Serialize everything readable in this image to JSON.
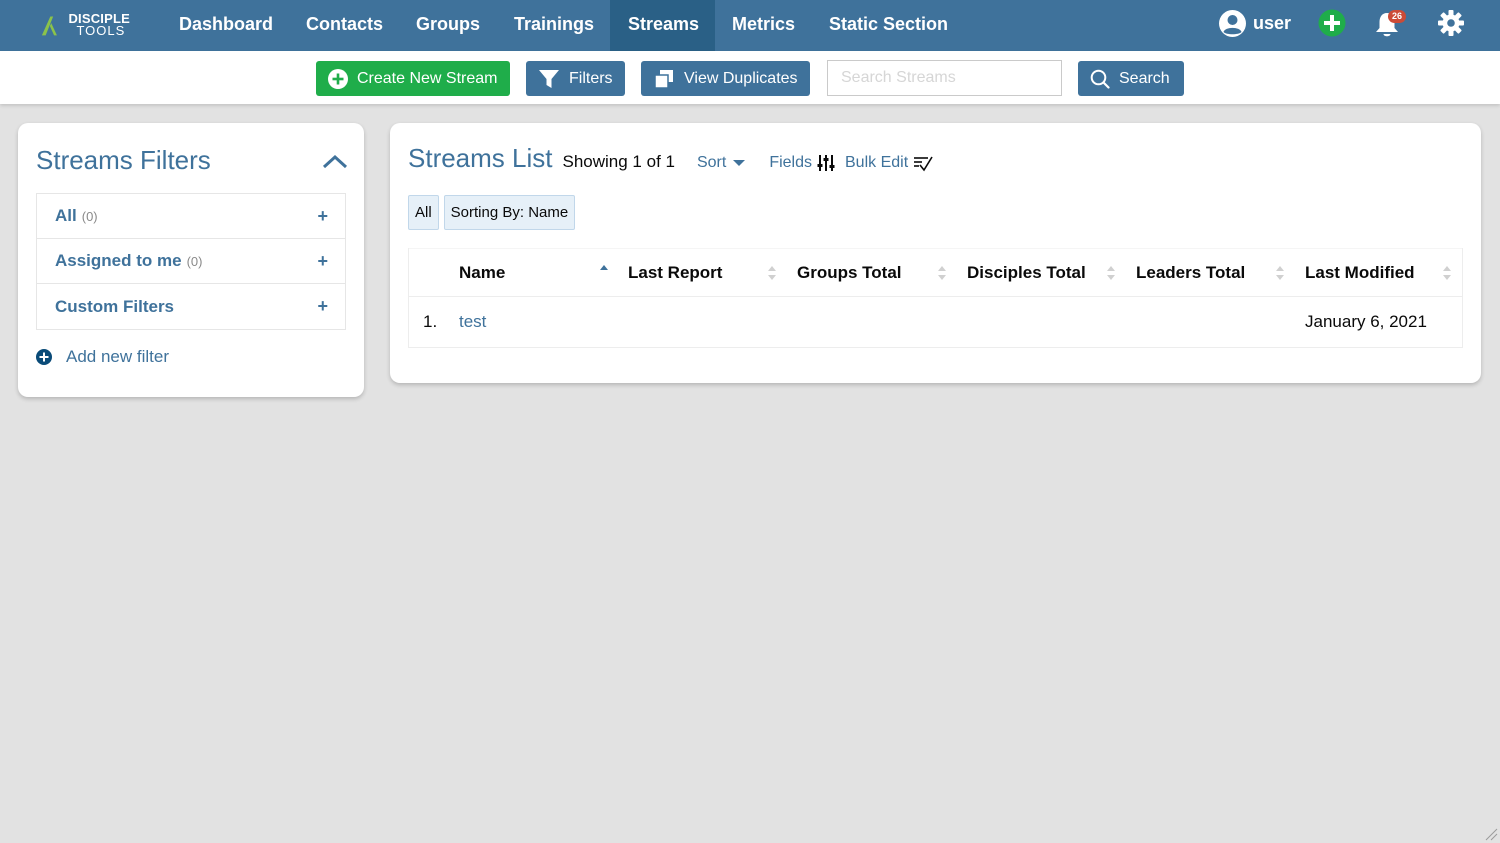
{
  "brand": {
    "line1": "DISCIPLE",
    "line2": "TOOLS"
  },
  "nav": {
    "items": [
      {
        "label": "Dashboard"
      },
      {
        "label": "Contacts"
      },
      {
        "label": "Groups"
      },
      {
        "label": "Trainings"
      },
      {
        "label": "Streams",
        "active": true
      },
      {
        "label": "Metrics"
      },
      {
        "label": "Static Section"
      }
    ],
    "user_label": "user",
    "notification_count": "26"
  },
  "toolbar": {
    "create_label": "Create New Stream",
    "filters_label": "Filters",
    "duplicates_label": "View Duplicates",
    "search_placeholder": "Search Streams",
    "search_value": "",
    "search_button_label": "Search"
  },
  "filters_panel": {
    "title": "Streams Filters",
    "items": [
      {
        "label": "All",
        "count": "(0)"
      },
      {
        "label": "Assigned to me",
        "count": "(0)"
      },
      {
        "label": "Custom Filters",
        "count": ""
      }
    ],
    "add_label": "Add new filter"
  },
  "list": {
    "title": "Streams List",
    "showing": "Showing 1 of 1",
    "sort_label": "Sort",
    "fields_label": "Fields",
    "bulk_edit_label": "Bulk Edit",
    "chips": [
      "All",
      "Sorting By: Name"
    ],
    "columns": [
      "Name",
      "Last Report",
      "Groups Total",
      "Disciples Total",
      "Leaders Total",
      "Last Modified"
    ],
    "rows": [
      {
        "index": "1.",
        "name": "test",
        "last_report": "",
        "groups_total": "",
        "disciples_total": "",
        "leaders_total": "",
        "last_modified": "January 6, 2021"
      }
    ]
  },
  "colors": {
    "nav_bg": "#3f729b",
    "nav_active": "#2a6086",
    "primary": "#3f729b",
    "success": "#1fad4a",
    "badge": "#cc4b37",
    "page_bg": "#e2e2e2"
  }
}
